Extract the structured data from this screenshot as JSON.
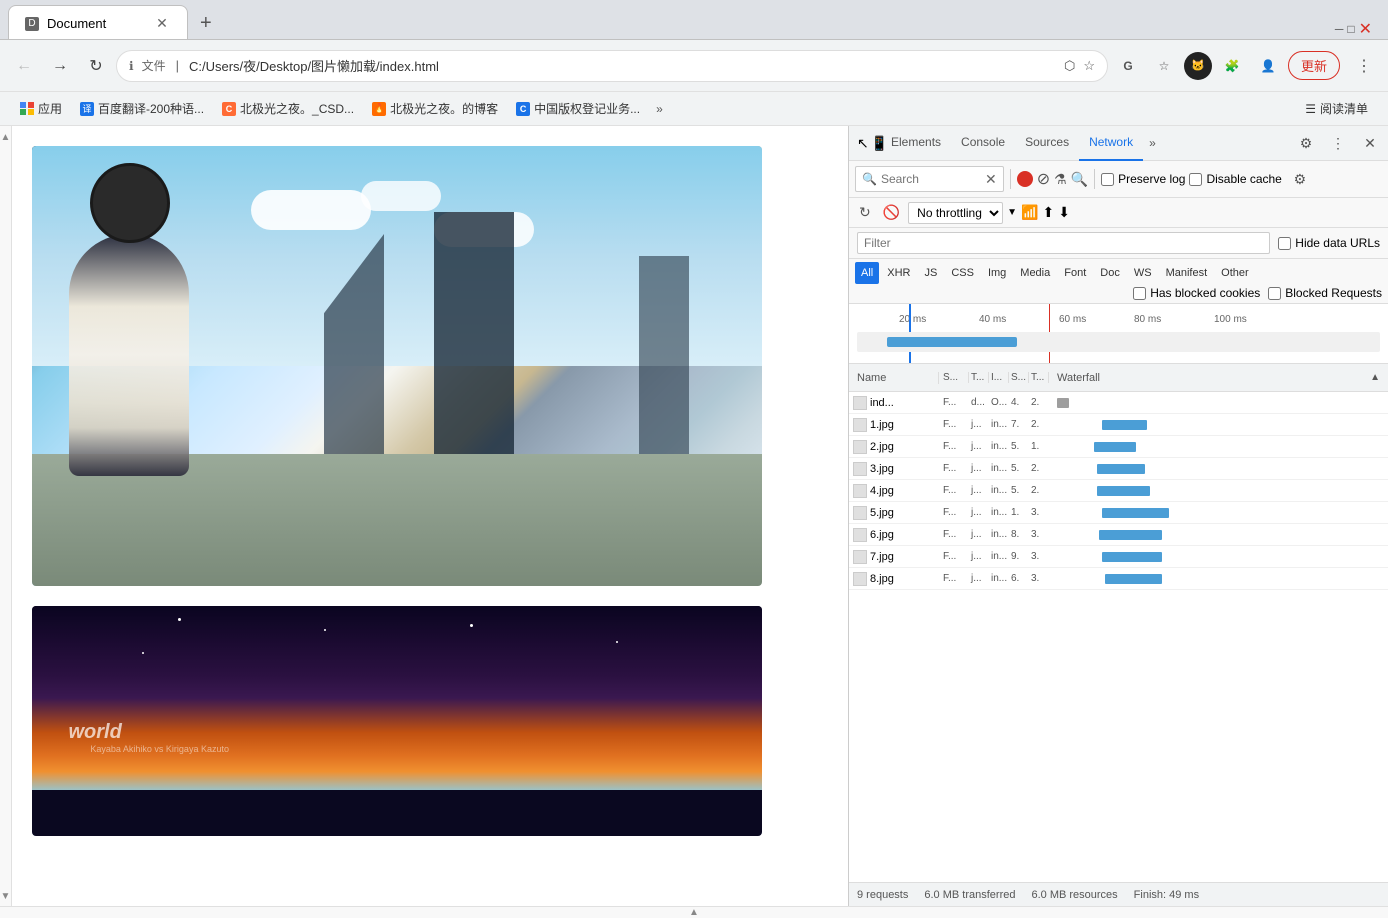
{
  "browser": {
    "tab_title": "Document",
    "url_secure": "文件",
    "url_path": "C:/Users/夜/Desktop/图片懒加载/index.html",
    "update_btn": "更新",
    "bookmarks": [
      {
        "icon": "🔲",
        "label": "应用",
        "color": "#4285f4"
      },
      {
        "icon": "译",
        "label": "百度翻译-200种语...",
        "color": "#1a73e8"
      },
      {
        "icon": "C",
        "label": "北极光之夜。_CSD...",
        "color": "#ff6b35"
      },
      {
        "icon": "🔥",
        "label": "北极光之夜。的博客",
        "color": "#ff6b00"
      },
      {
        "icon": "C",
        "label": "中国版权登记业务...",
        "color": "#1a73e8"
      }
    ],
    "bookmark_more": "»",
    "reading_mode": "阅读清单"
  },
  "devtools": {
    "tabs": [
      "Elements",
      "Console",
      "Sources",
      "Network"
    ],
    "active_tab": "Network",
    "more_tabs": "»",
    "search_placeholder": "Search",
    "search_label": "Search",
    "preserve_log": "Preserve log",
    "disable_cache": "Disable cache",
    "throttle": "No throttling",
    "filter_placeholder": "Filter",
    "hide_data_urls": "Hide data URLs",
    "filter_types": [
      "All",
      "XHR",
      "JS",
      "CSS",
      "Img",
      "Media",
      "Font",
      "Doc",
      "WS",
      "Manifest",
      "Other"
    ],
    "active_filter": "All",
    "has_blocked_cookies": "Has blocked cookies",
    "blocked_requests": "Blocked Requests",
    "table_headers": {
      "name": "Name",
      "status": "S...",
      "type": "T...",
      "initiator": "I...",
      "size": "S...",
      "time": "T...",
      "waterfall": "Waterfall"
    },
    "timeline": {
      "ticks": [
        "20 ms",
        "40 ms",
        "60 ms",
        "80 ms",
        "100 ms"
      ]
    },
    "rows": [
      {
        "name": "ind...",
        "status": "F...",
        "type": "d...",
        "initiator": "O...",
        "size": "4.",
        "time": "2.",
        "wf_start": 5,
        "wf_width": 8,
        "bar_type": "gray"
      },
      {
        "name": "1.jpg",
        "status": "F...",
        "type": "j...",
        "initiator": "in...",
        "size": "7.",
        "time": "2.",
        "wf_start": 35,
        "wf_width": 30,
        "bar_type": "blue"
      },
      {
        "name": "2.jpg",
        "status": "F...",
        "type": "j...",
        "initiator": "in...",
        "size": "5.",
        "time": "1.",
        "wf_start": 30,
        "wf_width": 28,
        "bar_type": "blue"
      },
      {
        "name": "3.jpg",
        "status": "F...",
        "type": "j...",
        "initiator": "in...",
        "size": "5.",
        "time": "2.",
        "wf_start": 32,
        "wf_width": 32,
        "bar_type": "blue"
      },
      {
        "name": "4.jpg",
        "status": "F...",
        "type": "j...",
        "initiator": "in...",
        "size": "5.",
        "time": "2.",
        "wf_start": 32,
        "wf_width": 35,
        "bar_type": "blue"
      },
      {
        "name": "5.jpg",
        "status": "F...",
        "type": "j...",
        "initiator": "in...",
        "size": "1.",
        "time": "3.",
        "wf_start": 35,
        "wf_width": 45,
        "bar_type": "blue"
      },
      {
        "name": "6.jpg",
        "status": "F...",
        "type": "j...",
        "initiator": "in...",
        "size": "8.",
        "time": "3.",
        "wf_start": 33,
        "wf_width": 42,
        "bar_type": "blue"
      },
      {
        "name": "7.jpg",
        "status": "F...",
        "type": "j...",
        "initiator": "in...",
        "size": "9.",
        "time": "3.",
        "wf_start": 35,
        "wf_width": 40,
        "bar_type": "blue"
      },
      {
        "name": "8.jpg",
        "status": "F...",
        "type": "j...",
        "initiator": "in...",
        "size": "6.",
        "time": "3.",
        "wf_start": 37,
        "wf_width": 38,
        "bar_type": "blue"
      }
    ],
    "status_bar": {
      "requests": "9 requests",
      "transferred": "6.0 MB transferred",
      "resources": "6.0 MB resources",
      "finish": "Finish: 49 ms"
    }
  }
}
